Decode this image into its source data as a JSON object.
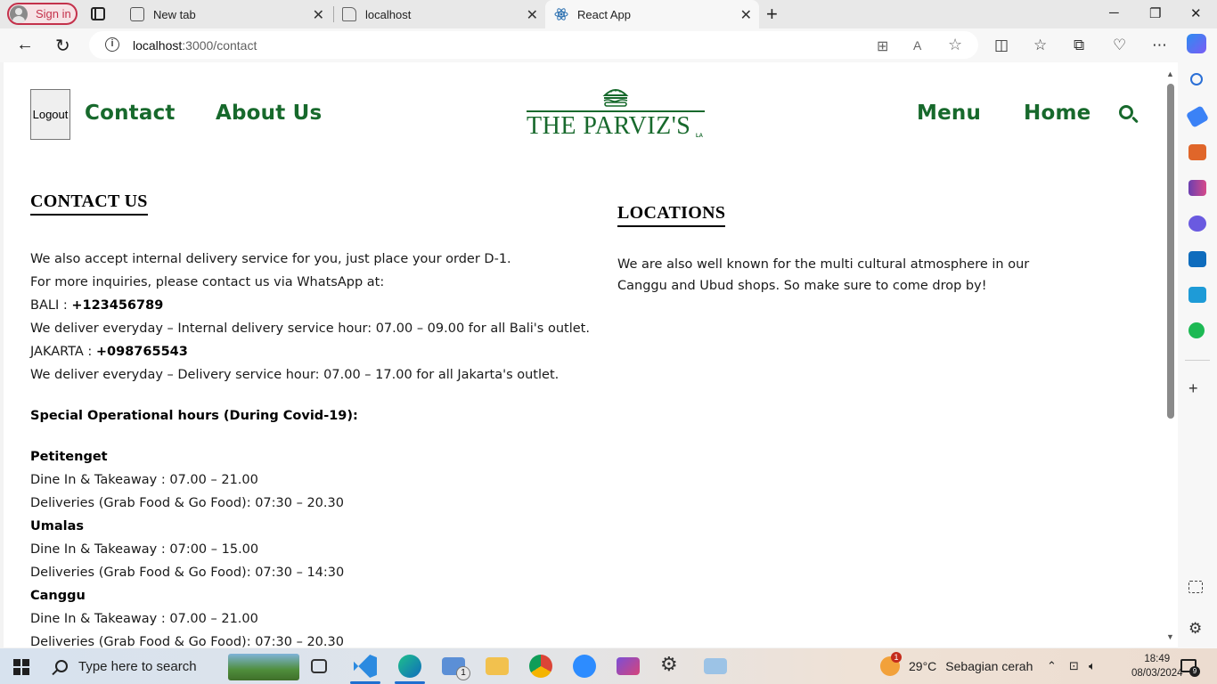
{
  "browser": {
    "signin_label": "Sign in",
    "tabs": [
      {
        "title": "New tab",
        "close": "✕"
      },
      {
        "title": "localhost",
        "close": "✕"
      },
      {
        "title": "React App",
        "close": "✕"
      }
    ],
    "url_host": "localhost",
    "url_path": ":3000/contact"
  },
  "site": {
    "logout_label": "Logout",
    "nav_left": [
      "Contact",
      "About Us"
    ],
    "nav_right": [
      "Menu",
      "Home"
    ],
    "brand": "THE PARVIZ'S",
    "brand_suffix": "LA"
  },
  "contact": {
    "title": "CONTACT US",
    "intro": "We also accept internal delivery service for you, just place your order D-1.",
    "inquiry": "For more inquiries, please contact us via WhatsApp at:",
    "bali_label": "BALI : ",
    "bali_phone": "+123456789",
    "bali_note": "We deliver everyday – Internal delivery service hour: 07.00 – 09.00 for all Bali's outlet.",
    "jakarta_label": "JAKARTA : ",
    "jakarta_phone": "+098765543",
    "jakarta_note": "We deliver everyday – Delivery service hour: 07.00 – 17.00 for all Jakarta's outlet.",
    "special_heading": "Special Operational hours (During Covid-19):",
    "outlets": [
      {
        "name": "Petitenget",
        "dine": "Dine In & Takeaway : 07.00 – 21.00",
        "delivery": "Deliveries (Grab Food & Go Food): 07:30 – 20.30"
      },
      {
        "name": "Umalas",
        "dine": "Dine In & Takeaway : 07:00 – 15.00",
        "delivery": "Deliveries (Grab Food & Go Food): 07:30 – 14:30"
      },
      {
        "name": "Canggu",
        "dine": "Dine In & Takeaway : 07.00 – 21.00",
        "delivery": "Deliveries (Grab Food & Go Food): 07:30 – 20.30"
      }
    ]
  },
  "locations": {
    "title": "LOCATIONS",
    "text_line1": "We are also well known for the multi cultural atmosphere in our",
    "text_line2": "Canggu and Ubud shops. So make sure to come drop by!"
  },
  "taskbar": {
    "search_placeholder": "Type here to search",
    "mail_badge": "1",
    "temperature": "29°C",
    "weather_desc": "Sebagian cerah",
    "time": "18:49",
    "date": "08/03/2024"
  },
  "colors": {
    "brand_green": "#17692c",
    "signin_red": "#c4314b"
  }
}
